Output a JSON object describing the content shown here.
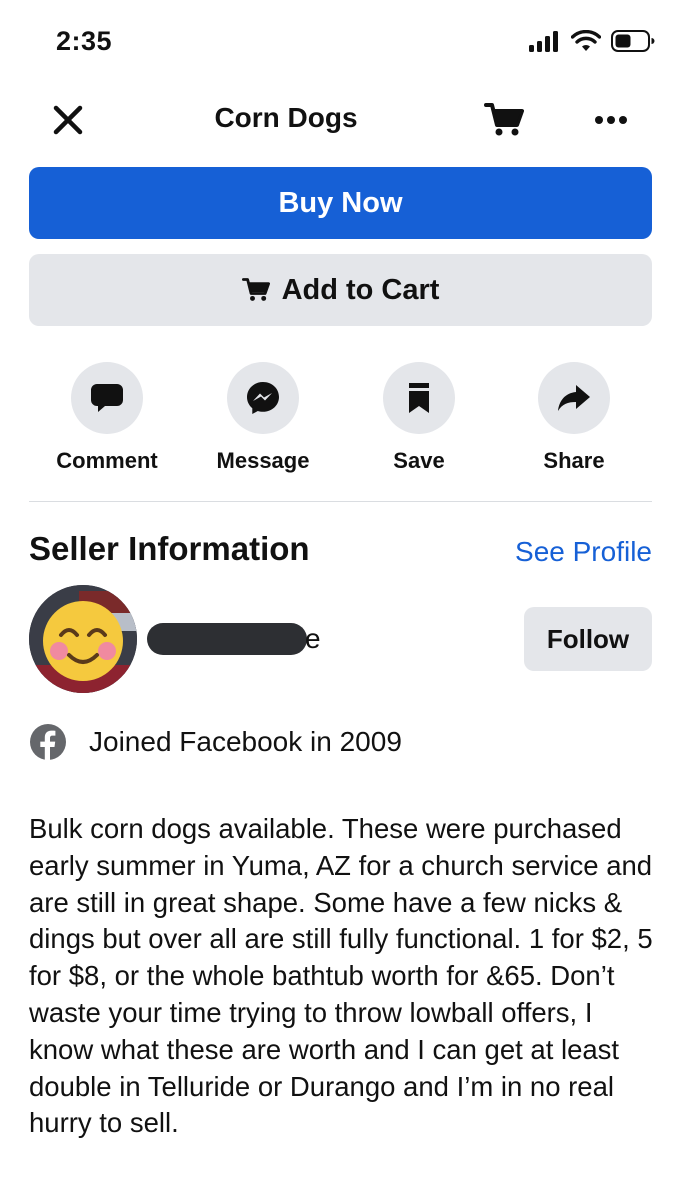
{
  "status_bar": {
    "time": "2:35",
    "icons": [
      "signal-icon",
      "wifi-icon",
      "battery-icon"
    ]
  },
  "nav": {
    "title": "Corn Dogs",
    "icons": [
      "close-icon",
      "cart-icon",
      "more-icon"
    ]
  },
  "buttons": {
    "buy_now": "Buy Now",
    "add_to_cart": "Add to Cart"
  },
  "actions": [
    {
      "label": "Comment",
      "icon": "comment-icon"
    },
    {
      "label": "Message",
      "icon": "messenger-icon"
    },
    {
      "label": "Save",
      "icon": "bookmark-icon"
    },
    {
      "label": "Share",
      "icon": "share-icon"
    }
  ],
  "seller": {
    "heading": "Seller Information",
    "see_profile": "See Profile",
    "name_visible_suffix": "e",
    "follow_label": "Follow",
    "joined": "Joined Facebook in 2009"
  },
  "description": "Bulk corn dogs available. These were purchased early summer in Yuma, AZ for a church service and are still in great shape. Some have a few nicks & dings but over all are still fully functional. 1 for $2, 5 for $8, or the whole bathtub worth for &65. Don’t waste your time trying to throw lowball offers, I know what these are worth and I can get at least double in Telluride or Durango and I’m in no real hurry to sell.",
  "colors": {
    "primary": "#1660d6",
    "secondary_bg": "#e4e6ea",
    "text": "#111111",
    "link": "#1660d6"
  }
}
